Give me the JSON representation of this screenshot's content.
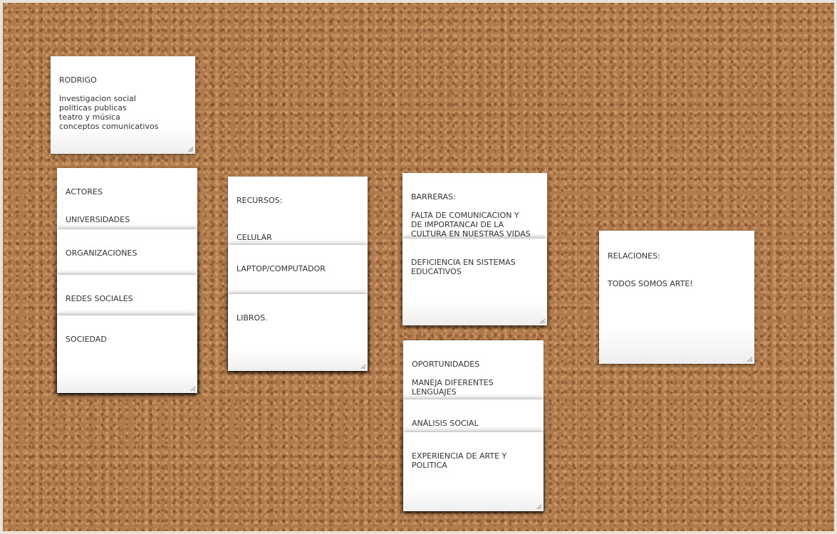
{
  "board": {
    "notes": [
      {
        "id": "rodrigo",
        "text": "RODRIGO\n\nInvestigacion social\npoliticas publicas\nteatro y música\nconceptos comunicativos"
      },
      {
        "id": "actores",
        "text": "ACTORES\n\n\nUNIVERSIDADES"
      },
      {
        "id": "organizaciones",
        "text": "ORGANIZACIONES"
      },
      {
        "id": "redes",
        "text": "REDES SOCIALES"
      },
      {
        "id": "sociedad",
        "text": "SOCIEDAD"
      },
      {
        "id": "recursos",
        "text": "RECURSOS:\n\n\n\nCELULAR"
      },
      {
        "id": "laptop",
        "text": "LAPTOP/COMPUTADOR"
      },
      {
        "id": "libros",
        "text": "LIBROS."
      },
      {
        "id": "barreras",
        "text": "BARRERAS:\n\nFALTA DE COMUNICACION Y\nDE IMPORTANCAI DE LA\nCULTURA EN NUESTRAS VIDAS"
      },
      {
        "id": "deficiencia",
        "text": "DEFICIENCIA EN SISTEMAS\nEDUCATIVOS"
      },
      {
        "id": "oportunidades",
        "text": "OPORTUNIDADES\n\nMANEJA DIFERENTES\nLENGUAJES"
      },
      {
        "id": "analisis",
        "text": "ANÁLISIS SOCIAL"
      },
      {
        "id": "experiencia",
        "text": "EXPERIENCIA DE ARTE Y\nPOLITICA"
      },
      {
        "id": "relaciones",
        "text": "RELACIONES:\n\n\nTODOS SOMOS ARTE!"
      }
    ]
  }
}
